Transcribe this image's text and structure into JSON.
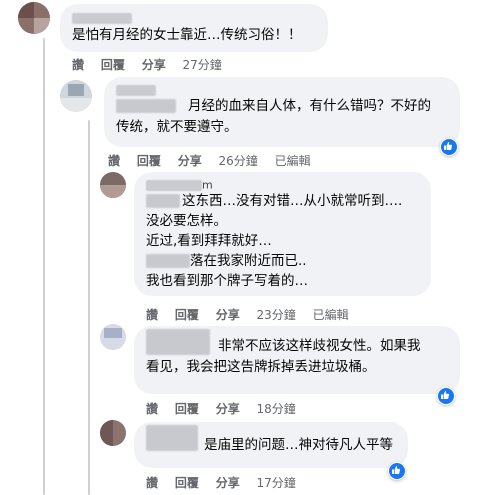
{
  "comments": [
    {
      "name_visible": "",
      "lines": [
        "是怕有月经的女士靠近…传统习俗！！"
      ],
      "actions": {
        "like": "讚",
        "reply": "回覆",
        "share": "分享",
        "time": "27分鐘",
        "edited": ""
      }
    },
    {
      "name_visible": "",
      "lines": [
        "月经的血来自人体，有什么错吗？不好的",
        "传统，就不要遵守。"
      ],
      "actions": {
        "like": "讚",
        "reply": "回覆",
        "share": "分享",
        "time": "26分鐘",
        "edited": "已編輯"
      }
    },
    {
      "name_visible": "m",
      "lines": [
        "这东西…没有对错…从小就常听到….",
        "没必要怎样。",
        "近过,看到拜拜就好…",
        "落在我家附近而已..",
        "我也看到那个牌子写着的…"
      ],
      "actions": {
        "like": "讚",
        "reply": "回覆",
        "share": "分享",
        "time": "23分鐘",
        "edited": "已編輯"
      }
    },
    {
      "name_visible": "",
      "lines": [
        "非常不应该这样歧视女性。如果我",
        "看见，我会把这告牌拆掉丢进垃圾桶。"
      ],
      "actions": {
        "like": "讚",
        "reply": "回覆",
        "share": "分享",
        "time": "18分鐘",
        "edited": ""
      }
    },
    {
      "name_visible": "",
      "lines": [
        "是庙里的问题…神对待凡人平等"
      ],
      "actions": {
        "like": "讚",
        "reply": "回覆",
        "share": "分享",
        "time": "17分鐘",
        "edited": ""
      }
    }
  ],
  "reaction_icon": "thumbs-up-icon",
  "colors": {
    "bubble": "#f0f2f5",
    "meta": "#65676b",
    "like_blue": "#1877f2",
    "thread": "#ced0d4"
  }
}
